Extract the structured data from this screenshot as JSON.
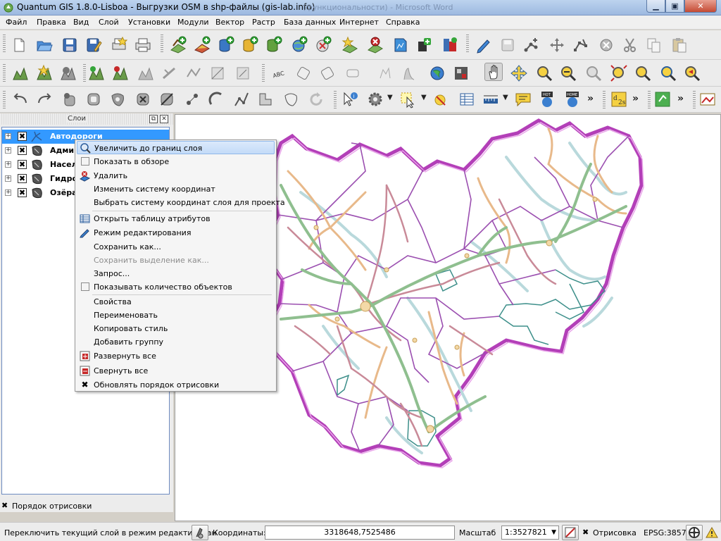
{
  "window": {
    "title": "Quantum GIS 1.8.0-Lisboa - Выгрузки OSM в shp-файлы (gis-lab.info)",
    "background_title": "(функциональности) - Microsoft Word",
    "minimize_icon": "minimize-icon",
    "maximize_icon": "maximize-icon",
    "close_icon": "close-icon"
  },
  "menubar": {
    "items": [
      "Файл",
      "Правка",
      "Вид",
      "Слой",
      "Установки",
      "Модули",
      "Вектор",
      "Растр",
      "База данных",
      "Интернет",
      "Справка"
    ]
  },
  "toolbars": {
    "row1_icons": [
      "new-project-icon",
      "open-project-icon",
      "save-project-icon",
      "save-as-icon",
      "new-print-composer-icon",
      "print-manager-icon",
      "add-vector-layer-icon",
      "add-raster-layer-icon",
      "add-postgis-layer-icon",
      "add-spatialite-layer-icon",
      "add-mssql-layer-icon",
      "add-wms-layer-icon",
      "add-wcs-layer-icon",
      "add-wfs-layer-icon",
      "remove-layer-icon",
      "new-shapefile-icon",
      "new-spatialite-layer-icon",
      "add-oracle-layer-icon",
      "edit-pencil-icon",
      "save-edits-icon",
      "add-feature-icon",
      "move-feature-icon",
      "node-tool-icon",
      "delete-selected-icon",
      "cut-features-icon",
      "copy-features-icon",
      "paste-features-icon"
    ],
    "row2_icons": [
      "simplify-icon",
      "add-ring-icon",
      "add-part-icon",
      "fill-ring-icon",
      "delete-ring-icon",
      "delete-part-icon",
      "reshape-icon",
      "offset-curve-icon",
      "split-features-icon",
      "split-parts-icon",
      "merge-features-icon",
      "label-icon",
      "move-label-icon",
      "rotate-label-icon",
      "change-label-icon",
      "pin-labels-icon",
      "show-hide-labels-icon",
      "globe-icon",
      "pan-icon",
      "pan-to-selected-icon",
      "zoom-in-icon",
      "zoom-out-icon",
      "zoom-native-icon",
      "zoom-full-icon",
      "zoom-to-layer-icon",
      "zoom-to-selection-icon",
      "zoom-last-icon"
    ],
    "row3_icons": [
      "undo-icon",
      "redo-icon",
      "rotate-point-icon",
      "digitize-polygon-icon",
      "fill-polygon-icon",
      "delete-polygon-icon",
      "split-polygon-icon",
      "add-point-icon",
      "snap-icon",
      "reshape-polygon-icon",
      "merge-polygon-icon",
      "refresh-icon",
      "identify-icon",
      "actions-gear-icon",
      "select-features-icon",
      "deselect-icon",
      "attribute-table-icon",
      "measure-line-icon",
      "map-tips-icon",
      "new-bookmark-icon",
      "show-bookmarks-icon",
      "d2s-icon",
      "plugin-green-icon",
      "image-export-icon"
    ],
    "more_chevron": "»"
  },
  "layers_panel": {
    "title": "Слои",
    "float_icon": "float-icon",
    "close_icon": "close-icon",
    "layers": [
      {
        "name": "Автодороги",
        "checked": true,
        "selected": true,
        "icon": "line-layer-icon"
      },
      {
        "name": "Админ",
        "checked": true,
        "selected": false,
        "icon": "polygon-layer-icon"
      },
      {
        "name": "Населё",
        "checked": true,
        "selected": false,
        "icon": "polygon-layer-icon"
      },
      {
        "name": "Гидрос",
        "checked": true,
        "selected": false,
        "icon": "line-layer-icon"
      },
      {
        "name": "Озёра,",
        "checked": true,
        "selected": false,
        "icon": "polygon-layer-icon"
      }
    ],
    "check_mark": "✖",
    "expander": "+",
    "render_order_label": "Порядок отрисовки",
    "render_order_checked": true
  },
  "context_menu": {
    "items": [
      {
        "label": "Увеличить до границ слоя",
        "icon": "zoom-to-layer-icon",
        "highlighted": true
      },
      {
        "label": "Показать в обзоре",
        "check": true
      },
      {
        "label": "Удалить",
        "icon": "remove-layer-icon"
      },
      {
        "label": "Изменить систему координат"
      },
      {
        "label": "Выбрать систему координат слоя для проекта"
      },
      {
        "separator": true
      },
      {
        "label": "Открыть таблицу атрибутов",
        "icon": "attribute-table-icon"
      },
      {
        "label": "Режим редактирования",
        "icon": "edit-pencil-icon"
      },
      {
        "label": "Сохранить как..."
      },
      {
        "label": "Сохранить выделение как...",
        "disabled": true
      },
      {
        "label": "Запрос..."
      },
      {
        "label": "Показывать количество объектов",
        "check": true
      },
      {
        "separator": true
      },
      {
        "label": "Свойства"
      },
      {
        "label": "Переименовать"
      },
      {
        "label": "Копировать стиль"
      },
      {
        "label": "Добавить группу"
      },
      {
        "label": "Развернуть все",
        "icon": "expand-all-icon"
      },
      {
        "label": "Свернуть все",
        "icon": "collapse-all-icon"
      },
      {
        "label": "Обновлять порядок отрисовки",
        "icon": "check-x-icon"
      }
    ]
  },
  "statusbar": {
    "message": "Переключить текущий слой в режим редактирован",
    "coords_label": "Координаты:",
    "coords_value": "3318648,7525486",
    "scale_label": "Масштаб",
    "scale_value": "1:3527821",
    "render_label": "Отрисовка",
    "render_checked": true,
    "epsg": "EPSG:3857",
    "scale_dropdown_icon": "chevron-down-icon",
    "stop_render_icon": "stop-render-icon",
    "projection_icon": "projection-icon",
    "messages_icon": "warning-icon",
    "edit_toggle_icon": "edit-toggle-icon"
  },
  "colors": {
    "admin_boundary": "#b33fb8",
    "region_boundary": "#d680d8",
    "roads_major": "#8fbf8f",
    "roads_secondary": "#e8b98a",
    "roads_local": "#c98a98",
    "hydro": "#b9d9dc",
    "water_polys": "#3d8f8a",
    "selection": "#3399ff"
  }
}
